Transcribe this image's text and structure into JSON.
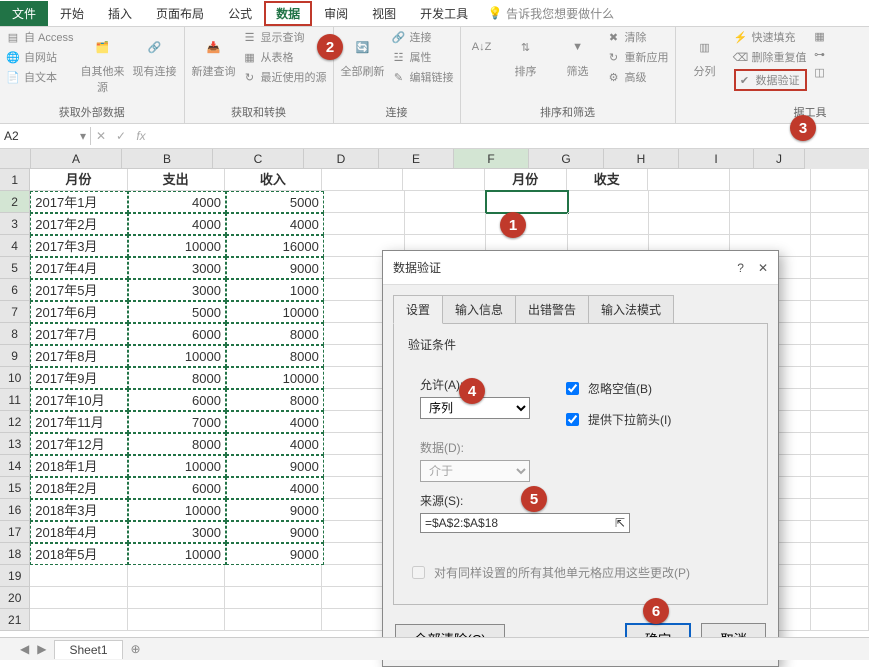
{
  "tabs": {
    "file": "文件",
    "home": "开始",
    "insert": "插入",
    "page_layout": "页面布局",
    "formulas": "公式",
    "data": "数据",
    "review": "审阅",
    "view": "视图",
    "developer": "开发工具",
    "tell_me": "告诉我您想要做什么"
  },
  "ribbon": {
    "ext_data": {
      "access": "自 Access",
      "web": "自网站",
      "text": "自文本",
      "other": "自其他来源",
      "existing": "现有连接",
      "label": "获取外部数据"
    },
    "get_transform": {
      "new_query": "新建查询",
      "show": "显示查询",
      "from_table": "从表格",
      "recent": "最近使用的源",
      "label": "获取和转换"
    },
    "connections": {
      "refresh_all": "全部刷新",
      "conn": "连接",
      "prop": "属性",
      "edit_links": "编辑链接",
      "label": "连接"
    },
    "sort_filter": {
      "sort": "排序",
      "filter": "筛选",
      "clear": "清除",
      "reapply": "重新应用",
      "advanced": "高级",
      "label": "排序和筛选"
    },
    "data_tools": {
      "text_to_cols": "分列",
      "flash_fill": "快速填充",
      "remove_dup": "删除重复值",
      "data_validation": "数据验证",
      "label": "据工具"
    }
  },
  "name_box": "A2",
  "fx_label": "fx",
  "columns": [
    "A",
    "B",
    "C",
    "D",
    "E",
    "F",
    "G",
    "H",
    "I",
    "J"
  ],
  "headers": {
    "A": "月份",
    "B": "支出",
    "C": "收入",
    "F": "月份",
    "G": "收支"
  },
  "rows": [
    {
      "a": "2017年1月",
      "b": 4000,
      "c": 5000
    },
    {
      "a": "2017年2月",
      "b": 4000,
      "c": 4000
    },
    {
      "a": "2017年3月",
      "b": 10000,
      "c": 16000
    },
    {
      "a": "2017年4月",
      "b": 3000,
      "c": 9000
    },
    {
      "a": "2017年5月",
      "b": 3000,
      "c": 1000
    },
    {
      "a": "2017年6月",
      "b": 5000,
      "c": 10000
    },
    {
      "a": "2017年7月",
      "b": 6000,
      "c": 8000
    },
    {
      "a": "2017年8月",
      "b": 10000,
      "c": 8000
    },
    {
      "a": "2017年9月",
      "b": 8000,
      "c": 10000
    },
    {
      "a": "2017年10月",
      "b": 6000,
      "c": 8000
    },
    {
      "a": "2017年11月",
      "b": 7000,
      "c": 4000
    },
    {
      "a": "2017年12月",
      "b": 8000,
      "c": 4000
    },
    {
      "a": "2018年1月",
      "b": 10000,
      "c": 9000
    },
    {
      "a": "2018年2月",
      "b": 6000,
      "c": 4000
    },
    {
      "a": "2018年3月",
      "b": 10000,
      "c": 9000
    },
    {
      "a": "2018年4月",
      "b": 3000,
      "c": 9000
    },
    {
      "a": "2018年5月",
      "b": 10000,
      "c": 9000
    }
  ],
  "dialog": {
    "title": "数据验证",
    "tabs": {
      "settings": "设置",
      "input": "输入信息",
      "error": "出错警告",
      "ime": "输入法模式"
    },
    "criteria_label": "验证条件",
    "allow_label": "允许(A):",
    "allow_value": "序列",
    "ignore_blank": "忽略空值(B)",
    "in_cell_dropdown": "提供下拉箭头(I)",
    "data_label": "数据(D):",
    "data_value": "介于",
    "source_label": "来源(S):",
    "source_value": "=$A$2:$A$18",
    "apply_same": "对有同样设置的所有其他单元格应用这些更改(P)",
    "clear_all": "全部清除(C)",
    "ok": "确定",
    "cancel": "取消"
  },
  "sheet": {
    "name": "Sheet1"
  },
  "badges": {
    "b1": "1",
    "b2": "2",
    "b3": "3",
    "b4": "4",
    "b5": "5",
    "b6": "6"
  }
}
